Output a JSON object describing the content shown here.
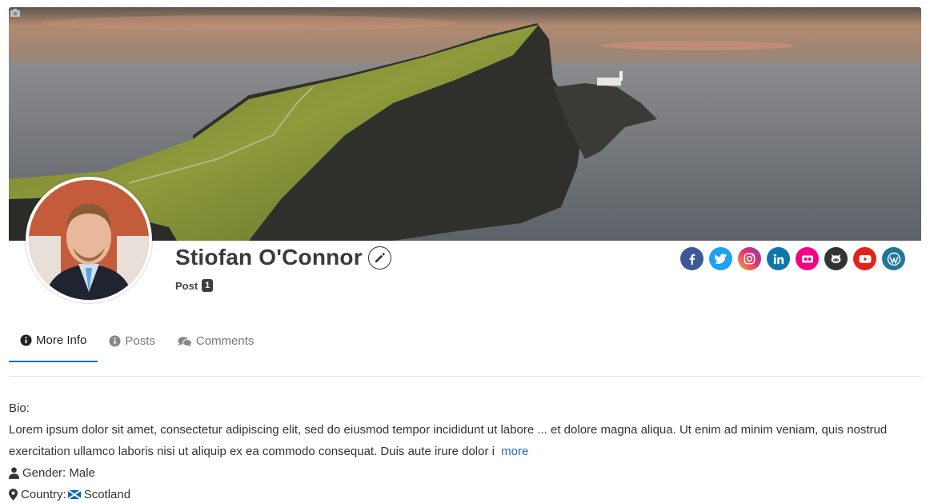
{
  "profile": {
    "name": "Stiofan O'Connor",
    "post_label": "Post",
    "post_count": "1"
  },
  "icons": {
    "cover": "camera-icon",
    "edit": "pencil-icon",
    "social": [
      "facebook-icon",
      "twitter-icon",
      "instagram-icon",
      "linkedin-icon",
      "flickr-icon",
      "github-icon",
      "youtube-icon",
      "wordpress-icon"
    ]
  },
  "social_colors": {
    "facebook": "#3b5998",
    "twitter": "#1da1f2",
    "instagram": "#e1306c",
    "linkedin": "#0e76a8",
    "flickr": "#f40083",
    "github": "#333333",
    "youtube": "#e62117",
    "wordpress": "#21759b"
  },
  "tabs": [
    {
      "label": "More Info",
      "icon": "info-icon",
      "active": true
    },
    {
      "label": "Posts",
      "icon": "info-icon",
      "active": false
    },
    {
      "label": "Comments",
      "icon": "comments-icon",
      "active": false
    }
  ],
  "info": {
    "bio_label": "Bio:",
    "bio_text": "Lorem ipsum dolor sit amet, consectetur adipiscing elit, sed do eiusmod tempor incididunt ut labore ... et dolore magna aliqua. Ut enim ad minim veniam, quis nostrud exercitation ullamco laboris nisi ut aliquip ex ea commodo consequat. Duis aute irure dolor i",
    "more_link": "more",
    "gender": "Gender: Male",
    "country_label": "Country:",
    "country_value": "Scotland"
  },
  "accent_color": "#1a6ec0"
}
